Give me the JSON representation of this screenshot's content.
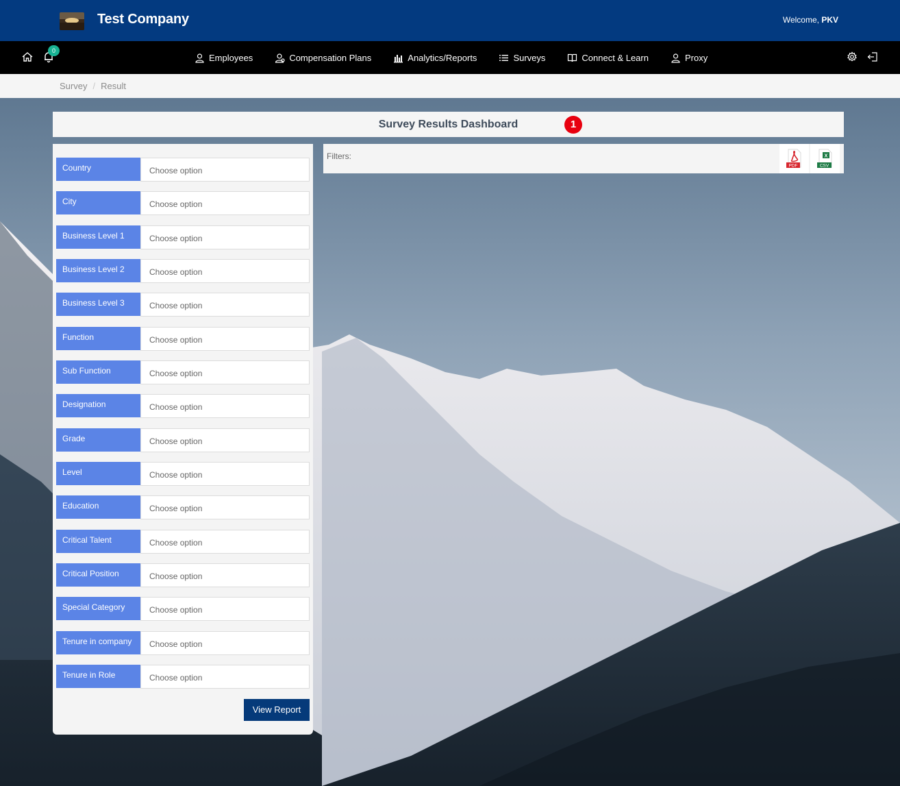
{
  "header": {
    "company": "Test Company",
    "welcome_prefix": "Welcome, ",
    "user": "PKV"
  },
  "nav": {
    "notification_count": "0",
    "items": [
      {
        "label": "Employees",
        "icon": "user-icon"
      },
      {
        "label": "Compensation Plans",
        "icon": "user-money-icon"
      },
      {
        "label": "Analytics/Reports",
        "icon": "bar-chart-icon"
      },
      {
        "label": "Surveys",
        "icon": "list-icon"
      },
      {
        "label": "Connect & Learn",
        "icon": "book-icon"
      },
      {
        "label": "Proxy",
        "icon": "user-icon"
      }
    ]
  },
  "breadcrumb": {
    "items": [
      "Survey",
      "Result"
    ]
  },
  "dashboard": {
    "title": "Survey Results Dashboard",
    "step": "1"
  },
  "filters": {
    "placeholder": "Choose option",
    "fields": [
      "Country",
      "City",
      "Business Level 1",
      "Business Level 2",
      "Business Level 3",
      "Function",
      "Sub Function",
      "Designation",
      "Grade",
      "Level",
      "Education",
      "Critical Talent",
      "Critical Position",
      "Special Category",
      "Tenure in company",
      "Tenure in Role"
    ],
    "view_report": "View Report",
    "filters_label": "Filters:",
    "export": {
      "pdf": "PDF",
      "csv": "CSV"
    }
  },
  "colors": {
    "header": "#033a80",
    "navbar": "#000000",
    "filter_label": "#5b84e6",
    "button": "#053a7a",
    "badge": "#19b394",
    "step_badge": "#e8000f"
  }
}
